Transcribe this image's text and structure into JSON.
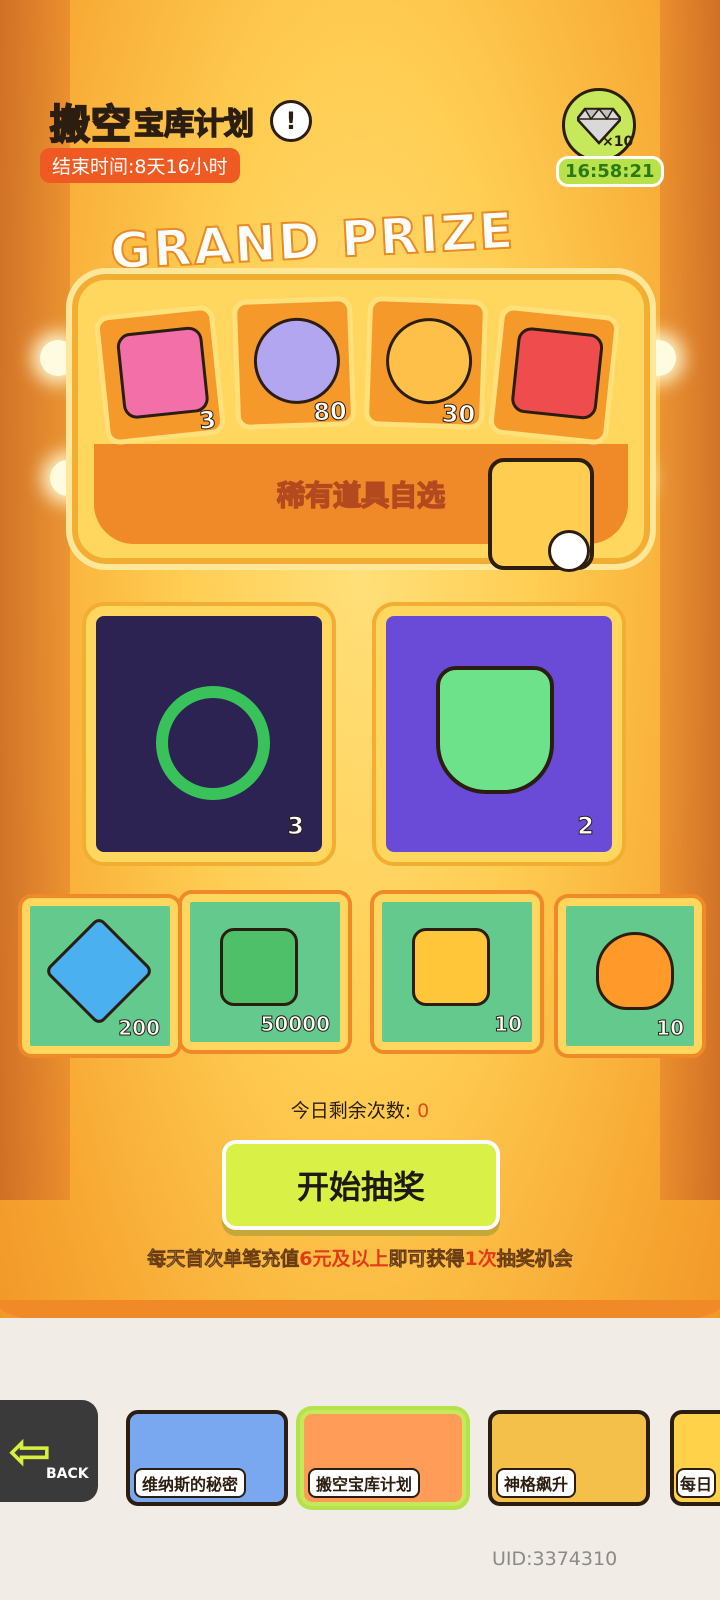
{
  "header": {
    "title_part1": "搬空",
    "title_part2": "宝库计划",
    "end_time": "结束时间:8天16小时",
    "gem_count": "×10",
    "timer": "16:58:21"
  },
  "grand_prize": {
    "title": "GRAND PRIZE",
    "items": [
      {
        "icon": "ticket-icon",
        "count": "3"
      },
      {
        "icon": "can-purple-icon",
        "count": "80"
      },
      {
        "icon": "can-orange-icon",
        "count": "30"
      },
      {
        "icon": "red-cube-icon",
        "count": ""
      }
    ],
    "choose_label": "稀有道具自选"
  },
  "middle_cards": [
    {
      "icon": "check-ticket-icon",
      "count": "3"
    },
    {
      "icon": "drink-cup-icon",
      "count": "2"
    }
  ],
  "bottom_tiles": [
    {
      "icon": "diamond-icon",
      "count": "200"
    },
    {
      "icon": "money-icon",
      "count": "50000"
    },
    {
      "icon": "coin-cards-icon",
      "count": "10"
    },
    {
      "icon": "fire-icon",
      "count": "10"
    }
  ],
  "remaining": {
    "label": "今日剩余次数:",
    "value": "0"
  },
  "start_button": "开始抽奖",
  "note": {
    "part1": "每天首次单笔充值",
    "highlight1": "6元及以上",
    "part2": "即可获得",
    "highlight2": "1次",
    "part3": "抽奖机会"
  },
  "footer": {
    "back_label": "BACK",
    "nav": [
      {
        "label": "维纳斯的秘密"
      },
      {
        "label": "搬空宝库计划"
      },
      {
        "label": "神格飙升"
      },
      {
        "label": "每日"
      }
    ],
    "uid": "UID:3374310"
  },
  "colors": {
    "accent": "#d9f046",
    "highlight": "#e33a1a",
    "background": "#f7b63a"
  }
}
